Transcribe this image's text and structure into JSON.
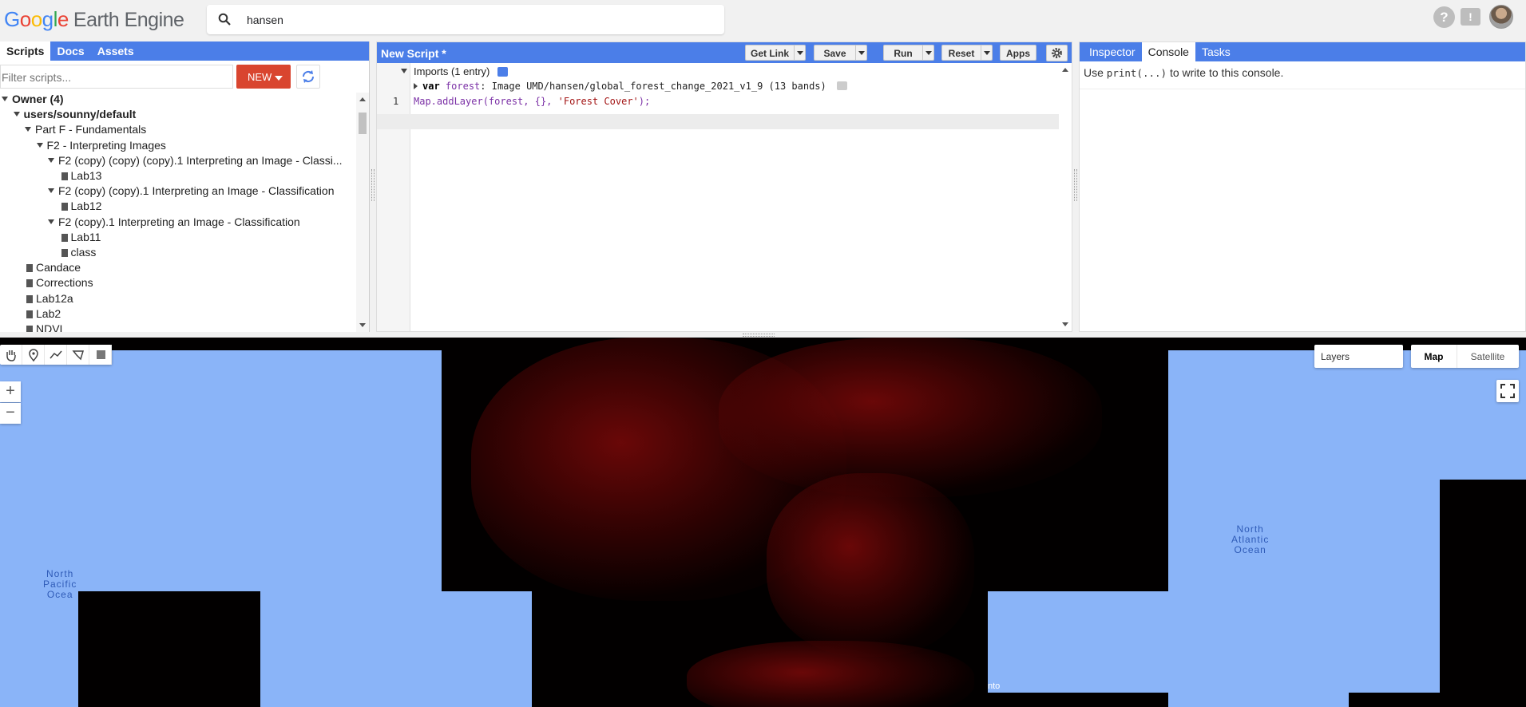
{
  "header": {
    "logo": {
      "g1": "G",
      "g2": "o",
      "g3": "o",
      "g4": "g",
      "g5": "l",
      "g6": "e",
      "product": "Earth Engine"
    },
    "search_value": "hansen",
    "icons": [
      "help-icon",
      "feedback-icon",
      "avatar"
    ]
  },
  "left_panel": {
    "tabs": [
      "Scripts",
      "Docs",
      "Assets"
    ],
    "filter_placeholder": "Filter scripts...",
    "new_button": "NEW",
    "tree": [
      {
        "label": "Owner (4)",
        "bold": true,
        "type": "folder"
      },
      {
        "label": "users/sounny/default",
        "bold": true,
        "type": "folder"
      },
      {
        "label": "Part F - Fundamentals",
        "type": "folder"
      },
      {
        "label": "F2 - Interpreting Images",
        "type": "folder"
      },
      {
        "label": "F2 (copy) (copy) (copy).1 Interpreting an Image - Classi...",
        "type": "folder"
      },
      {
        "label": "Lab13",
        "type": "file"
      },
      {
        "label": "F2 (copy) (copy).1 Interpreting an Image - Classification",
        "type": "folder"
      },
      {
        "label": "Lab12",
        "type": "file"
      },
      {
        "label": "F2 (copy).1 Interpreting an Image - Classification",
        "type": "folder"
      },
      {
        "label": "Lab11",
        "type": "file"
      },
      {
        "label": "class",
        "type": "file"
      },
      {
        "label": "Candace",
        "type": "file"
      },
      {
        "label": "Corrections",
        "type": "file"
      },
      {
        "label": "Lab12a",
        "type": "file"
      },
      {
        "label": "Lab2",
        "type": "file"
      },
      {
        "label": "NDVI",
        "type": "file"
      }
    ]
  },
  "editor": {
    "title": "New Script *",
    "buttons": {
      "get_link": "Get Link",
      "save": "Save",
      "run": "Run",
      "reset": "Reset",
      "apps": "Apps"
    },
    "imports_label": "Imports (1 entry)",
    "import_line": {
      "kw": "var",
      "name": "forest",
      "rest": ": Image UMD/hansen/global_forest_change_2021_v1_9 (13 bands)"
    },
    "line_number": "1",
    "code": {
      "fn": "Map.addLayer(forest, {}, ",
      "str": "'Forest Cover'",
      "end": ");"
    }
  },
  "right_panel": {
    "tabs": [
      "Inspector",
      "Console",
      "Tasks"
    ],
    "active_tab": "Console",
    "console_hint": {
      "pre": "Use ",
      "code": "print(...)",
      "post": " to write to this console."
    }
  },
  "map": {
    "labels": {
      "north_pacific": [
        "North",
        "Pacific",
        "Ocea"
      ],
      "north_atlantic": [
        "North",
        "Atlantic",
        "Ocean"
      ],
      "fragment": "nto"
    },
    "layers_label": "Layers",
    "map_types": [
      "Map",
      "Satellite"
    ],
    "active_map_type": "Map",
    "colors": {
      "ocean": "#8ab4f8",
      "tile": "#020000",
      "forest": "#8c0a0a"
    }
  }
}
